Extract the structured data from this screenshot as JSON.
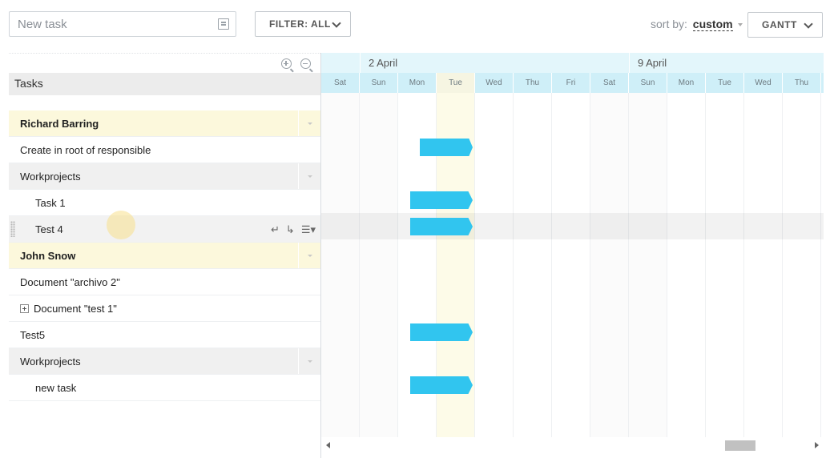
{
  "toolbar": {
    "new_task_placeholder": "New task",
    "filter_label": "FILTER: ALL",
    "sort_label": "sort by:",
    "sort_value": "custom",
    "view_label": "GANTT"
  },
  "grid": {
    "header": "Tasks",
    "rows": [
      {
        "label": "Richard Barring",
        "type": "person"
      },
      {
        "label": "Create in root of responsible",
        "type": "task"
      },
      {
        "label": "Workprojects",
        "type": "group"
      },
      {
        "label": "Task 1",
        "type": "subtask"
      },
      {
        "label": "Test 4",
        "type": "subtask"
      },
      {
        "label": "John Snow",
        "type": "person"
      },
      {
        "label": "Document \"archivo 2\"",
        "type": "task"
      },
      {
        "label": "Document \"test 1\"",
        "type": "task"
      },
      {
        "label": "Test5",
        "type": "task"
      },
      {
        "label": "Workprojects",
        "type": "group"
      },
      {
        "label": "new task",
        "type": "subtask"
      }
    ]
  },
  "gantt": {
    "weeks": [
      "2 April",
      "9 April"
    ],
    "days": [
      "Sat",
      "Sun",
      "Mon",
      "Tue",
      "Wed",
      "Thu",
      "Fri",
      "Sat",
      "Sun",
      "Mon",
      "Tue",
      "Wed",
      "Thu"
    ],
    "bar_color": "#31c5ef"
  }
}
